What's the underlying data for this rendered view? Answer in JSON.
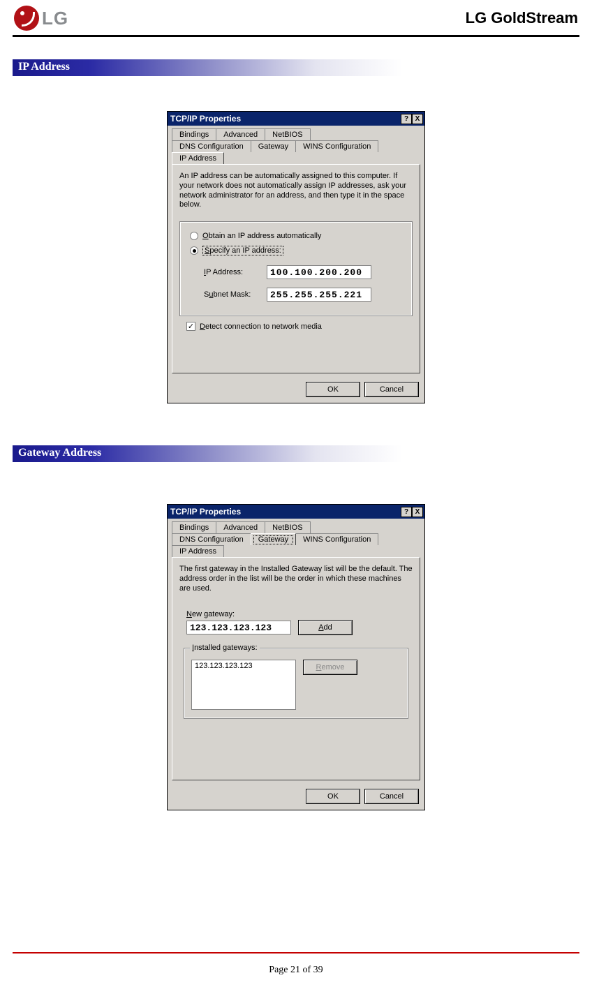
{
  "header": {
    "logo_text": "LG",
    "product_name": "LG GoldStream"
  },
  "sections": {
    "ip": "IP Address",
    "gateway": "Gateway Address"
  },
  "dialog1": {
    "title": "TCP/IP Properties",
    "tabs": {
      "bindings": "Bindings",
      "advanced": "Advanced",
      "netbios": "NetBIOS",
      "dns": "DNS Configuration",
      "gateway": "Gateway",
      "wins": "WINS Configuration",
      "ip": "IP Address"
    },
    "desc": "An IP address can be automatically assigned to this computer. If your network does not automatically assign IP addresses, ask your network administrator for an address, and then type it in the space below.",
    "radio_obtain": "Obtain an IP address automatically",
    "radio_specify": "Specify an IP address:",
    "ip_label": "IP Address:",
    "ip_value": "100.100.200.200",
    "subnet_label": "Subnet Mask:",
    "subnet_value": "255.255.255.221",
    "detect": "Detect connection to network media",
    "ok": "OK",
    "cancel": "Cancel",
    "help_btn": "?",
    "close_btn": "X"
  },
  "dialog2": {
    "title": "TCP/IP Properties",
    "tabs": {
      "bindings": "Bindings",
      "advanced": "Advanced",
      "netbios": "NetBIOS",
      "dns": "DNS Configuration",
      "gateway": "Gateway",
      "wins": "WINS Configuration",
      "ip": "IP Address"
    },
    "desc": "The first gateway in the Installed Gateway list will be the default. The address order in the list will be the order in which these machines are used.",
    "new_gw_label": "New gateway:",
    "new_gw_value": "123.123.123.123",
    "add": "Add",
    "installed_label": "Installed gateways:",
    "installed_item": "123.123.123.123",
    "remove": "Remove",
    "ok": "OK",
    "cancel": "Cancel",
    "help_btn": "?",
    "close_btn": "X"
  },
  "footer": {
    "page": "Page 21 of 39"
  }
}
